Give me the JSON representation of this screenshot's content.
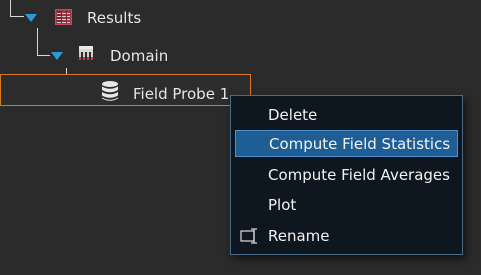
{
  "tree": {
    "items": [
      {
        "label": "Results",
        "icon": "table-icon"
      },
      {
        "label": "Domain",
        "icon": "domain-grid-icon"
      },
      {
        "label": "Field Probe 1",
        "icon": "database-icon"
      }
    ]
  },
  "context_menu": {
    "items": [
      {
        "label": "Delete"
      },
      {
        "label": "Compute Field Statistics"
      },
      {
        "label": "Compute Field Averages"
      },
      {
        "label": "Plot"
      },
      {
        "label": "Rename",
        "icon": "rename-icon"
      }
    ],
    "highlighted_index": 1
  },
  "colors": {
    "background": "#2b2b2b",
    "expand_arrow": "#2c9ad8",
    "selection_outline": "#d87822",
    "menu_background": "#0e1620",
    "menu_highlight": "#1f5e94"
  }
}
